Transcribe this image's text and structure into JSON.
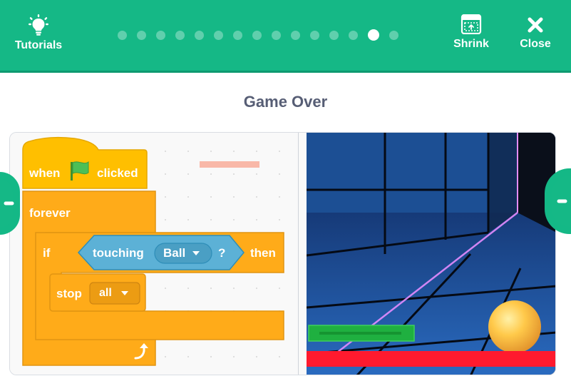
{
  "header": {
    "tutorials_label": "Tutorials",
    "shrink_label": "Shrink",
    "close_label": "Close",
    "progress": {
      "total_steps": 15,
      "current_step": 14
    },
    "bg_color": "#15b886"
  },
  "title": "Game Over",
  "code": {
    "hat": {
      "when": "when",
      "clicked": "clicked",
      "flag_icon": "green-flag-icon"
    },
    "forever": "forever",
    "if_block": {
      "if": "if",
      "then": "then"
    },
    "touching": {
      "label": "touching",
      "value": "Ball",
      "question": "?"
    },
    "stop": {
      "label": "stop",
      "value": "all"
    },
    "colors": {
      "control": "#ffab19",
      "sensing": "#5cb1d6",
      "events": "#ffbf00"
    }
  },
  "stage": {
    "paddle_color": "#1fb040",
    "floor_color": "#ff1a2e",
    "ball_color": "#f8b43c"
  },
  "nav": {
    "left_icon": "chevron-left-icon",
    "right_icon": "chevron-right-icon"
  }
}
